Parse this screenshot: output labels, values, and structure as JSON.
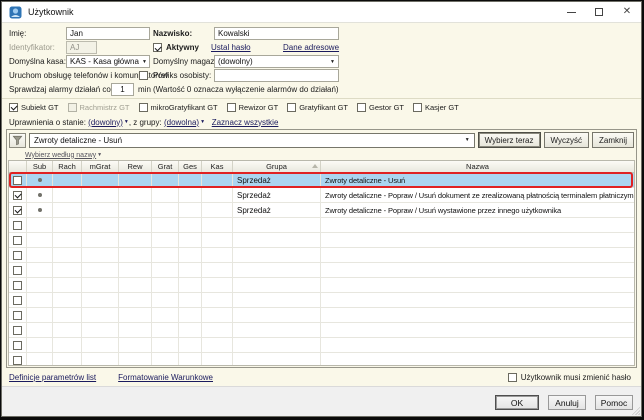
{
  "window": {
    "title": "Użytkownik"
  },
  "form": {
    "imie_label": "Imię:",
    "imie_value": "Jan",
    "nazwisko_label": "Nazwisko:",
    "nazwisko_value": "Kowalski",
    "identyfikator_label": "Identyfikator:",
    "identyfikator_value": "AJ",
    "aktywny_label": "Aktywny",
    "ustal_haslo": "Ustal hasło",
    "dane_adresowe": "Dane adresowe",
    "kasa_label": "Domyślna kasa:",
    "kasa_value": "KAS - Kasa główna",
    "magazyn_label": "Domyślny magazyn:",
    "magazyn_value": "(dowolny)",
    "telefony_label": "Uruchom obsługę telefonów i komunikatorów",
    "prefiks_label": "Prefiks osobisty:",
    "prefiks_value": "",
    "alarmy_label": "Sprawdzaj alarmy działań co:",
    "alarmy_value": "1",
    "alarmy_unit": "min",
    "alarmy_hint": "(Wartość 0 oznacza wyłączenie alarmów do działań)"
  },
  "products": [
    {
      "label": "Subiekt GT",
      "checked": true,
      "disabled": false
    },
    {
      "label": "Rachmistrz GT",
      "checked": false,
      "disabled": true
    },
    {
      "label": "mikroGratyfikant GT",
      "checked": false,
      "disabled": false
    },
    {
      "label": "Rewizor GT",
      "checked": false,
      "disabled": false
    },
    {
      "label": "Gratyfikant GT",
      "checked": false,
      "disabled": false
    },
    {
      "label": "Gestor GT",
      "checked": false,
      "disabled": false
    },
    {
      "label": "Kasjer GT",
      "checked": false,
      "disabled": false
    }
  ],
  "permissions_bar": {
    "state_label": "Uprawnienia o stanie:",
    "state_value": "(dowolny)",
    "group_label": ", z grupy:",
    "group_value": "(dowolna)",
    "select_all": "Zaznacz wszystkie"
  },
  "filter": {
    "query": "Zwroty detaliczne - Usuń",
    "by_name": "Wybierz według nazwy",
    "choose_now": "Wybierz teraz",
    "clear": "Wyczyść",
    "close": "Zamknij"
  },
  "table": {
    "columns": [
      "",
      "Sub",
      "Rach",
      "mGrat",
      "Rew",
      "Grat",
      "Ges",
      "Kas",
      "Grupa",
      "Nazwa"
    ],
    "rows": [
      {
        "checked": false,
        "sub": true,
        "grupa": "Sprzedaż",
        "nazwa": "Zwroty detaliczne - Usuń",
        "selected": true
      },
      {
        "checked": true,
        "sub": true,
        "grupa": "Sprzedaż",
        "nazwa": "Zwroty detaliczne - Popraw / Usuń dokument ze zrealizowaną płatnością terminalem płatniczym",
        "selected": false
      },
      {
        "checked": true,
        "sub": true,
        "grupa": "Sprzedaż",
        "nazwa": "Zwroty detaliczne - Popraw / Usuń wystawione przez innego użytkownika",
        "selected": false
      }
    ],
    "empty_rows": 10
  },
  "bottom": {
    "link1": "Definicje parametrów list",
    "link2": "Formatowanie Warunkowe",
    "must_change_label": "Użytkownik musi zmienić hasło"
  },
  "buttons": {
    "ok": "OK",
    "cancel": "Anuluj",
    "help": "Pomoc"
  }
}
